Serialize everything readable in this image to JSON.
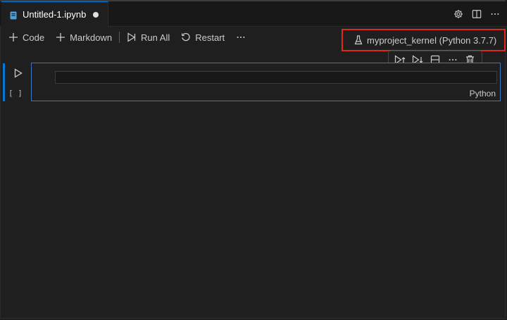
{
  "tab": {
    "filename": "Untitled-1.ipynb",
    "file_icon": "notebook-file-icon",
    "dirty": true
  },
  "tab_actions": [
    {
      "icon": "gear-icon"
    },
    {
      "icon": "split-editor-icon"
    },
    {
      "icon": "more-actions-icon"
    }
  ],
  "toolbar": {
    "code_label": "Code",
    "markdown_label": "Markdown",
    "run_all_label": "Run All",
    "restart_label": "Restart",
    "more_icon": "ellipsis-icon"
  },
  "kernel": {
    "label": "myproject_kernel (Python 3.7.7)",
    "icon": "kernel-flask-icon"
  },
  "cell": {
    "execution_count": "[ ]",
    "language": "Python",
    "source": ""
  },
  "cell_toolbar": [
    "execute-above-icon",
    "execute-below-icon",
    "split-cell-icon",
    "more-icon",
    "delete-icon"
  ],
  "colors": {
    "accent": "#0078d4",
    "highlight_border": "#e0281b",
    "background": "#1f1f1f"
  }
}
